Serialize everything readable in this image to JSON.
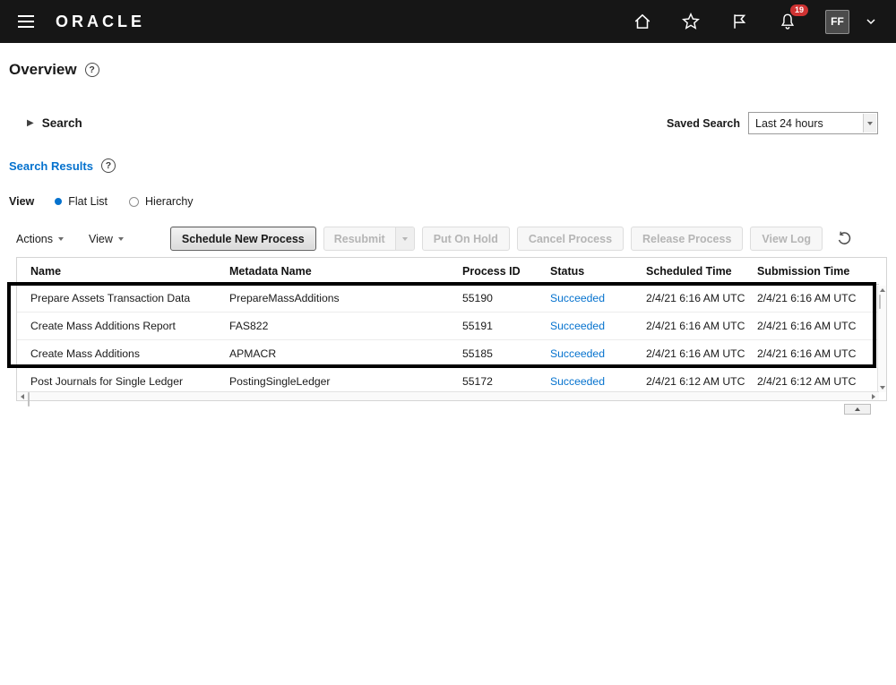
{
  "header": {
    "brand": "ORACLE",
    "notification_count": "19",
    "avatar_initials": "FF"
  },
  "page": {
    "title": "Overview"
  },
  "search": {
    "title": "Search",
    "saved_search_label": "Saved Search",
    "saved_search_value": "Last 24 hours"
  },
  "results": {
    "title": "Search Results",
    "view_label": "View",
    "view_options": [
      {
        "label": "Flat List",
        "selected": true
      },
      {
        "label": "Hierarchy",
        "selected": false
      }
    ]
  },
  "toolbar": {
    "menus": [
      {
        "label": "Actions"
      },
      {
        "label": "View"
      }
    ],
    "buttons": [
      {
        "label": "Schedule New Process",
        "enabled": true,
        "emphasized": true
      },
      {
        "label": "Resubmit",
        "enabled": false,
        "split": true
      },
      {
        "label": "Put On Hold",
        "enabled": false
      },
      {
        "label": "Cancel Process",
        "enabled": false
      },
      {
        "label": "Release Process",
        "enabled": false
      },
      {
        "label": "View Log",
        "enabled": false
      }
    ]
  },
  "table": {
    "columns": [
      "Name",
      "Metadata Name",
      "Process ID",
      "Status",
      "Scheduled Time",
      "Submission Time"
    ],
    "rows": [
      {
        "name": "Prepare Assets Transaction Data",
        "metadata_name": "PrepareMassAdditions",
        "process_id": "55190",
        "status": "Succeeded",
        "scheduled_time": "2/4/21 6:16 AM UTC",
        "submission_time": "2/4/21 6:16 AM UTC",
        "highlighted": true
      },
      {
        "name": "Create Mass Additions Report",
        "metadata_name": "FAS822",
        "process_id": "55191",
        "status": "Succeeded",
        "scheduled_time": "2/4/21 6:16 AM UTC",
        "submission_time": "2/4/21 6:16 AM UTC",
        "highlighted": true
      },
      {
        "name": "Create Mass Additions",
        "metadata_name": "APMACR",
        "process_id": "55185",
        "status": "Succeeded",
        "scheduled_time": "2/4/21 6:16 AM UTC",
        "submission_time": "2/4/21 6:16 AM UTC",
        "highlighted": true
      },
      {
        "name": "Post Journals for Single Ledger",
        "metadata_name": "PostingSingleLedger",
        "process_id": "55172",
        "status": "Succeeded",
        "scheduled_time": "2/4/21 6:12 AM UTC",
        "submission_time": "2/4/21 6:12 AM UTC",
        "highlighted": false
      }
    ]
  },
  "icons": {
    "disclosure": "▶",
    "help": "?"
  },
  "colors": {
    "accent_blue": "#0572ce",
    "status_blue": "#0572ce",
    "badge_red": "#cf3232",
    "topbar_bg": "#161616",
    "annotation": "#000000"
  }
}
